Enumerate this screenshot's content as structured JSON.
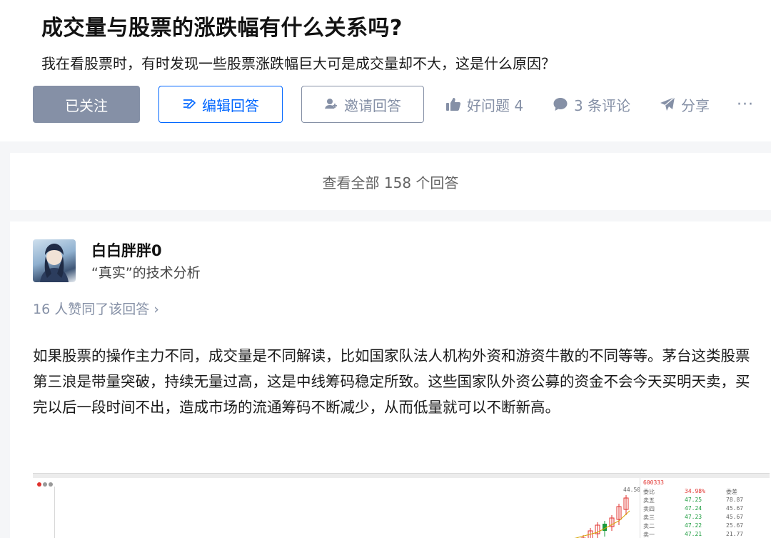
{
  "question": {
    "title": "成交量与股票的涨跌幅有什么关系吗?",
    "description": "我在看股票时，有时发现一些股票涨跌幅巨大可是成交量却不大，这是什么原因？",
    "buttons": {
      "followed": "已关注",
      "edit_answer": "编辑回答",
      "invite_answer": "邀请回答"
    },
    "actions": {
      "good_question": "好问题 4",
      "comments": "3 条评论",
      "share": "分享",
      "more": "···"
    }
  },
  "view_all": "查看全部 158 个回答",
  "answer": {
    "author": "白白胖胖0",
    "headline": "“真实”的技术分析",
    "votes": "16 人赞同了该回答 ›",
    "content": "如果股票的操作主力不同，成交量是不同解读，比如国家队法人机构外资和游资牛散的不同等等。茅台这类股票第三浪是带量突破，持续无量过高，这是中线筹码稳定所致。这些国家队外资公募的资金不会今天买明天卖，买完以后一段时间不出，造成市场的流通筹码不断减少，从而低量就可以不断新高。"
  },
  "embedded_chart": {
    "price_top": "44.50",
    "quote_code": "600333",
    "quote_rows": [
      {
        "label": "委比",
        "price": "34.98%",
        "vol": "委差"
      },
      {
        "label": "卖五",
        "price": "47.25",
        "vol": "78.87"
      },
      {
        "label": "卖四",
        "price": "47.24",
        "vol": "45.67"
      },
      {
        "label": "卖三",
        "price": "47.23",
        "vol": "45.67"
      },
      {
        "label": "卖二",
        "price": "47.22",
        "vol": "25.67"
      },
      {
        "label": "卖一",
        "price": "47.21",
        "vol": "21.77"
      }
    ]
  },
  "colors": {
    "accent": "#0066ff",
    "muted": "#8590a6",
    "followed_bg": "#8590a6",
    "page_bg": "#f5f6f8",
    "rise": "#e0312d",
    "fall": "#1a9b3c"
  }
}
